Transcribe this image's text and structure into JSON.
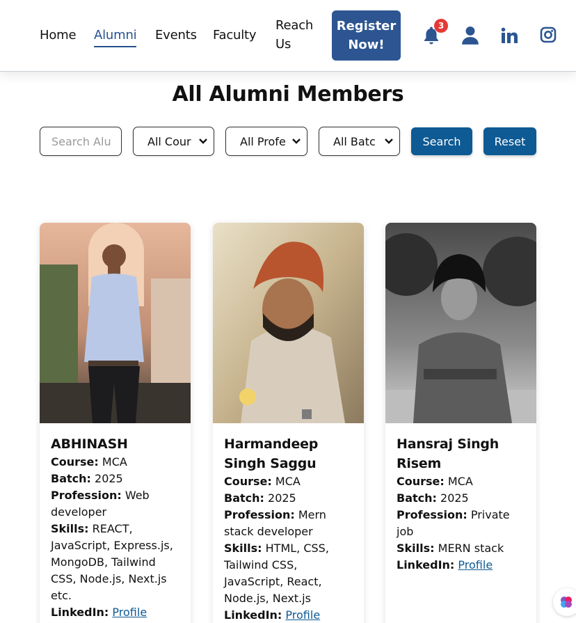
{
  "nav": {
    "links": [
      "Home",
      "Alumni",
      "Events",
      "Faculty",
      "Reach Us"
    ],
    "register": "Register Now!",
    "notification_count": "3",
    "icons": [
      "bell-icon",
      "user-icon",
      "linkedin-icon",
      "instagram-icon"
    ],
    "accent": "#2c5591"
  },
  "page": {
    "title": "All Alumni Members"
  },
  "filters": {
    "search_placeholder": "Search Alu",
    "course_selected": "All Cour",
    "profession_selected": "All Profe",
    "batch_selected": "All Batc",
    "search_label": "Search",
    "reset_label": "Reset",
    "button_color": "#0d5a94"
  },
  "alumni": [
    {
      "name": "ABHINASH",
      "course_label": "Course:",
      "course": "MCA",
      "batch_label": "Batch:",
      "batch": "2025",
      "profession_label": "Profession:",
      "profession": "Web developer",
      "skills_label": "Skills:",
      "skills": "REACT, JavaScript, Express.js, MongoDB, Tailwind CSS, Node.js, Next.js etc.",
      "linkedin_label": "LinkedIn:",
      "linkedin_link": "Profile"
    },
    {
      "name": "Harmandeep Singh Saggu",
      "course_label": "Course:",
      "course": "MCA",
      "batch_label": "Batch:",
      "batch": "2025",
      "profession_label": "Profession:",
      "profession": "Mern stack developer",
      "skills_label": "Skills:",
      "skills": "HTML, CSS, Tailwind CSS, JavaScript, React, Node.js, Next.js",
      "linkedin_label": "LinkedIn:",
      "linkedin_link": "Profile"
    },
    {
      "name": "Hansraj Singh Risem",
      "course_label": "Course:",
      "course": "MCA",
      "batch_label": "Batch:",
      "batch": "2025",
      "profession_label": "Profession:",
      "profession": "Private job",
      "skills_label": "Skills:",
      "skills": "MERN stack",
      "linkedin_label": "LinkedIn:",
      "linkedin_link": "Profile"
    }
  ]
}
